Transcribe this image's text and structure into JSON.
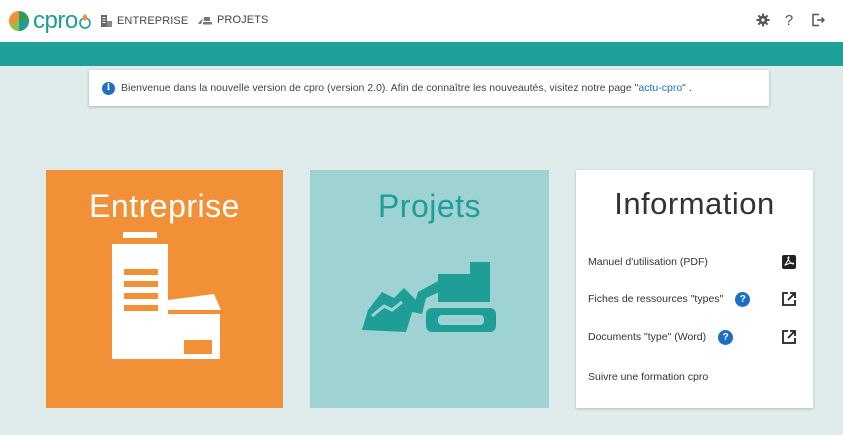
{
  "brand": {
    "name": "cpro"
  },
  "nav": {
    "entreprise_label": "ENTREPRISE",
    "projets_label": "PROJETS"
  },
  "toolbar": {
    "help_label": "?"
  },
  "notice": {
    "text": "Bienvenue dans la nouvelle version de cpro (version 2.0). Afin de connaître les nouveautés, visitez notre page \"",
    "link": " actu-cpro ",
    "text_end": "\" ."
  },
  "cards": {
    "entreprise": {
      "title": "Entreprise"
    },
    "projets": {
      "title": "Projets"
    },
    "information": {
      "title": "Information",
      "items": [
        {
          "label": "Manuel d'utilisation (PDF)",
          "icon": "pdf-icon"
        },
        {
          "label": "Fiches de ressources \"types\"",
          "icon": "external-link-icon",
          "help": "?"
        },
        {
          "label": "Documents \"type\" (Word)",
          "icon": "external-link-icon",
          "help": "?"
        },
        {
          "label": "Suivre une formation cpro"
        }
      ]
    }
  },
  "colors": {
    "teal": "#20a09a",
    "orange": "#f29037",
    "light_teal": "#9fd3d3",
    "background": "#dfeceb",
    "link_blue": "#1e6fc4"
  }
}
